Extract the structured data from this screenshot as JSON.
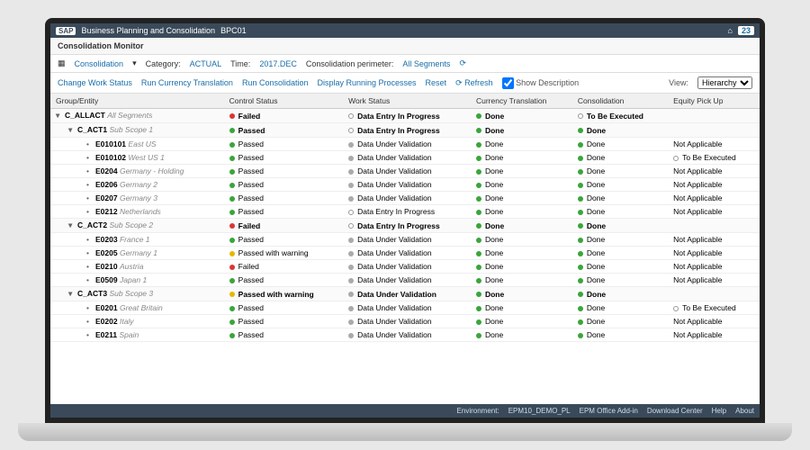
{
  "titlebar": {
    "logo": "SAP",
    "app_title": "Business Planning and Consolidation",
    "instance": "BPC01",
    "badge": "23"
  },
  "panel": {
    "title": "Consolidation Monitor"
  },
  "filters": {
    "consolidation_label": "Consolidation",
    "category_label": "Category:",
    "category_value": "ACTUAL",
    "time_label": "Time:",
    "time_value": "2017.DEC",
    "perimeter_label": "Consolidation perimeter:",
    "perimeter_value": "All Segments"
  },
  "actions": {
    "change_work_status": "Change Work Status",
    "run_currency": "Run Currency Translation",
    "run_consolidation": "Run Consolidation",
    "display_running": "Display Running Processes",
    "reset": "Reset",
    "refresh": "Refresh",
    "show_description": "Show Description",
    "view_label": "View:",
    "view_value": "Hierarchy"
  },
  "columns": {
    "group": "Group/Entity",
    "control": "Control Status",
    "work": "Work Status",
    "currency": "Currency Translation",
    "consolidation": "Consolidation",
    "equity": "Equity Pick Up"
  },
  "status_labels": {
    "failed": "Failed",
    "passed": "Passed",
    "passed_warn": "Passed with warning",
    "data_in_progress": "Data Entry In Progress",
    "data_under_val": "Data Under Validation",
    "done": "Done",
    "to_be_executed": "To Be Executed",
    "not_applicable": "Not Applicable"
  },
  "rows": [
    {
      "id": "C_ALLACT",
      "desc": "All Segments",
      "indent": 0,
      "selected": true,
      "group": true,
      "control": "failed",
      "work": "data_in_progress",
      "currency": "done",
      "cons": "to_be_executed",
      "equity": ""
    },
    {
      "id": "C_ACT1",
      "desc": "Sub Scope 1",
      "indent": 1,
      "group": true,
      "control": "passed",
      "work": "data_in_progress",
      "currency": "done",
      "cons": "done",
      "equity": ""
    },
    {
      "id": "E010101",
      "desc": "East US",
      "indent": 2,
      "control": "passed",
      "work": "data_under_val",
      "currency": "done",
      "cons": "done",
      "equity": "not_applicable"
    },
    {
      "id": "E010102",
      "desc": "West US 1",
      "indent": 2,
      "control": "passed",
      "work": "data_under_val",
      "currency": "done",
      "cons": "done",
      "equity": "to_be_executed"
    },
    {
      "id": "E0204",
      "desc": "Germany - Holding",
      "indent": 2,
      "control": "passed",
      "work": "data_under_val",
      "currency": "done",
      "cons": "done",
      "equity": "not_applicable"
    },
    {
      "id": "E0206",
      "desc": "Germany 2",
      "indent": 2,
      "control": "passed",
      "work": "data_under_val",
      "currency": "done",
      "cons": "done",
      "equity": "not_applicable"
    },
    {
      "id": "E0207",
      "desc": "Germany 3",
      "indent": 2,
      "control": "passed",
      "work": "data_under_val",
      "currency": "done",
      "cons": "done",
      "equity": "not_applicable"
    },
    {
      "id": "E0212",
      "desc": "Netherlands",
      "indent": 2,
      "control": "passed",
      "work": "data_in_progress",
      "currency": "done",
      "cons": "done",
      "equity": "not_applicable"
    },
    {
      "id": "C_ACT2",
      "desc": "Sub Scope 2",
      "indent": 1,
      "group": true,
      "control": "failed",
      "work": "data_in_progress",
      "currency": "done",
      "cons": "done",
      "equity": ""
    },
    {
      "id": "E0203",
      "desc": "France 1",
      "indent": 2,
      "control": "passed",
      "work": "data_under_val",
      "currency": "done",
      "cons": "done",
      "equity": "not_applicable"
    },
    {
      "id": "E0205",
      "desc": "Germany 1",
      "indent": 2,
      "control": "passed_warn",
      "work": "data_under_val",
      "currency": "done",
      "cons": "done",
      "equity": "not_applicable"
    },
    {
      "id": "E0210",
      "desc": "Austria",
      "indent": 2,
      "control": "failed",
      "work": "data_under_val",
      "currency": "done",
      "cons": "done",
      "equity": "not_applicable"
    },
    {
      "id": "E0509",
      "desc": "Japan 1",
      "indent": 2,
      "control": "passed",
      "work": "data_under_val",
      "currency": "done",
      "cons": "done",
      "equity": "not_applicable"
    },
    {
      "id": "C_ACT3",
      "desc": "Sub Scope 3",
      "indent": 1,
      "group": true,
      "control": "passed_warn",
      "work": "data_under_val",
      "currency": "done",
      "cons": "done",
      "equity": ""
    },
    {
      "id": "E0201",
      "desc": "Great Britain",
      "indent": 2,
      "control": "passed",
      "work": "data_under_val",
      "currency": "done",
      "cons": "done",
      "equity": "to_be_executed"
    },
    {
      "id": "E0202",
      "desc": "Italy",
      "indent": 2,
      "control": "passed",
      "work": "data_under_val",
      "currency": "done",
      "cons": "done",
      "equity": "not_applicable"
    },
    {
      "id": "E0211",
      "desc": "Spain",
      "indent": 2,
      "control": "passed",
      "work": "data_under_val",
      "currency": "done",
      "cons": "done",
      "equity": "not_applicable"
    }
  ],
  "footer": {
    "env_label": "Environment:",
    "env_value": "EPM10_DEMO_PL",
    "addin": "EPM Office Add-in",
    "download": "Download Center",
    "help": "Help",
    "about": "About"
  }
}
